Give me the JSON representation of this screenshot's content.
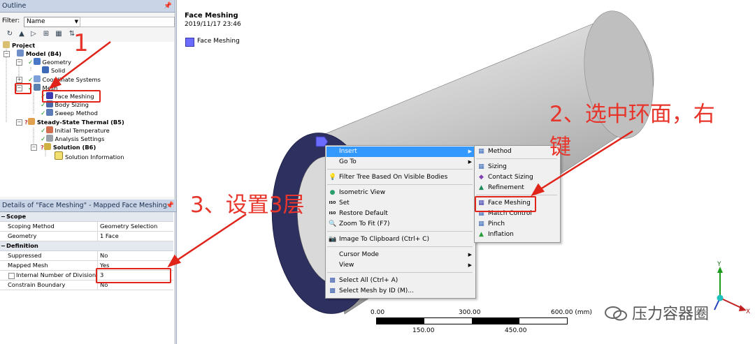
{
  "outline": {
    "title": "Outline",
    "pin": "ᵖ",
    "filter_label": "Filter:",
    "filter_value": "Name",
    "tree": [
      {
        "label": "Project"
      },
      {
        "label": "Model (B4)"
      },
      {
        "label": "Geometry"
      },
      {
        "label": "Solid"
      },
      {
        "label": "Coordinate Systems"
      },
      {
        "label": "Mesh"
      },
      {
        "label": "Face Meshing"
      },
      {
        "label": "Body Sizing"
      },
      {
        "label": "Sweep Method"
      },
      {
        "label": "Steady-State Thermal (B5)"
      },
      {
        "label": "Initial Temperature"
      },
      {
        "label": "Analysis Settings"
      },
      {
        "label": "Solution (B6)"
      },
      {
        "label": "Solution Information"
      }
    ]
  },
  "details": {
    "title": "Details of \"Face Meshing\" - Mapped Face Meshing",
    "sections": [
      {
        "name": "Scope",
        "rows": [
          {
            "key": "Scoping Method",
            "value": "Geometry Selection"
          },
          {
            "key": "Geometry",
            "value": "1 Face"
          }
        ]
      },
      {
        "name": "Definition",
        "rows": [
          {
            "key": "Suppressed",
            "value": "No"
          },
          {
            "key": "Mapped Mesh",
            "value": "Yes"
          },
          {
            "key": "Internal Number of Divisions",
            "value": "3"
          },
          {
            "key": "Constrain Boundary",
            "value": "No"
          }
        ]
      }
    ]
  },
  "viewport": {
    "title": "Face Meshing",
    "date": "2019/11/17 23:46",
    "legend_label": "Face Meshing",
    "legend_color": "#6b6bff"
  },
  "context_menu": {
    "items": [
      {
        "label": "Insert",
        "submenu": true
      },
      {
        "label": "Go To",
        "submenu": true
      },
      {
        "label": "Filter Tree Based On Visible Bodies"
      },
      {
        "label": "Isometric View"
      },
      {
        "label": "Set"
      },
      {
        "label": "Restore Default"
      },
      {
        "label": "Zoom To Fit (F7)"
      },
      {
        "label": "Image To Clipboard (Ctrl+ C)"
      },
      {
        "label": "Cursor Mode",
        "submenu": true
      },
      {
        "label": "View",
        "submenu": true
      },
      {
        "label": "Select All (Ctrl+ A)"
      },
      {
        "label": "Select Mesh by ID (M)..."
      }
    ],
    "iso_label": "ISO"
  },
  "insert_submenu": {
    "items": [
      {
        "label": "Method"
      },
      {
        "label": "Sizing"
      },
      {
        "label": "Contact Sizing"
      },
      {
        "label": "Refinement"
      },
      {
        "label": "Face Meshing"
      },
      {
        "label": "Match Control"
      },
      {
        "label": "Pinch"
      },
      {
        "label": "Inflation"
      }
    ]
  },
  "annotations": {
    "step1": "1",
    "step2_line1": "2、选中环面，右",
    "step2_line2": "键",
    "step3": "3、设置3层"
  },
  "scale": {
    "top_labels": [
      "0.00",
      "300.00",
      "600.00 (mm)"
    ],
    "bottom_labels": [
      "150.00",
      "450.00"
    ]
  },
  "triad": {
    "y": "Y",
    "x": "X"
  },
  "watermark": "压力容器圈",
  "colors": {
    "annotation_red": "#e0241a",
    "menu_highlight": "#3399ff",
    "cylinder_end": "#2e3060"
  }
}
